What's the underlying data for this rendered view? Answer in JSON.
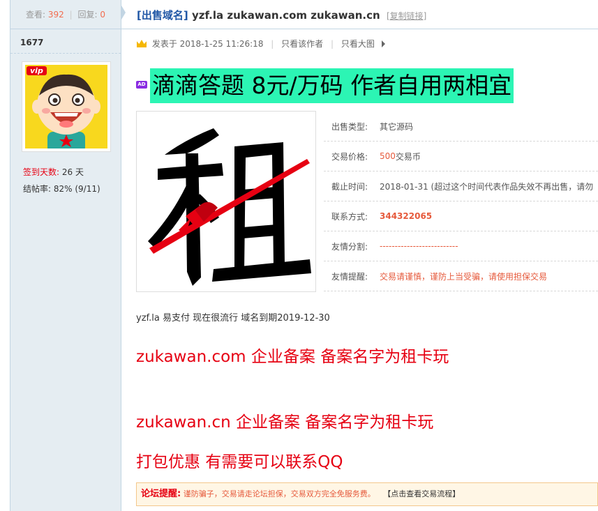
{
  "sidebar": {
    "views_label": "查看:",
    "views_count": "392",
    "replies_label": "回复:",
    "replies_count": "0",
    "user_id": "1677",
    "vip_badge": "vip",
    "signin_label": "签到天数:",
    "signin_value": "26 天",
    "close_rate_label": "结帖率:",
    "close_rate_value": "82% (9/11)"
  },
  "thread": {
    "category": "[出售域名]",
    "title": "yzf.la zukawan.com zukawan.cn",
    "copy_link": "[复制链接]",
    "posted_at": "发表于 2018-1-25 11:26:18",
    "only_author": "只看该作者",
    "only_big_image": "只看大图"
  },
  "post": {
    "ad_badge": "AD",
    "headline": "滴滴答题 8元/万码 作者自用两相宜",
    "product_image": "租-stamp-image",
    "info": [
      {
        "key": "出售类型:",
        "value": "其它源码",
        "style": "plain"
      },
      {
        "key": "交易价格:",
        "value": "500",
        "suffix": " 交易币",
        "style": "price"
      },
      {
        "key": "截止时间:",
        "value": "2018-01-31   (超过这个时间代表作品失效不再出售，请勿",
        "style": "plain"
      },
      {
        "key": "联系方式:",
        "value": "344322065",
        "style": "contact"
      },
      {
        "key": "友情分割:",
        "value": "--------------------------",
        "style": "red"
      },
      {
        "key": "友情提醒:",
        "value": "交易请谨慎，谨防上当受骗，请使用担保交易",
        "style": "red"
      }
    ],
    "description": "yzf.la 易支付 现在很流行 域名到期2019-12-30",
    "line1": "zukawan.com 企业备案 备案名字为租卡玩",
    "line2": "zukawan.cn 企业备案 备案名字为租卡玩",
    "line3": "打包优惠 有需要可以联系QQ"
  },
  "notice": {
    "label": "论坛提醒:",
    "text": "谨防骗子，交易请走论坛担保，交易双方完全免服务费。",
    "link": "【点击查看交易流程】"
  },
  "colors": {
    "sidebar_bg": "#e5edf2",
    "accent_blue": "#2258a6",
    "headline_bg": "#2cf5b4",
    "red": "#e60012"
  }
}
